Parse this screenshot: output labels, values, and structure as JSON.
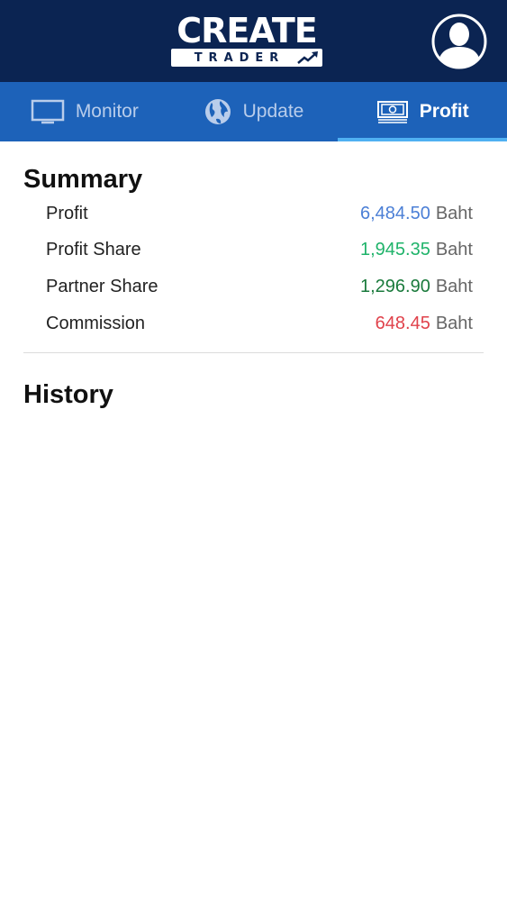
{
  "header": {
    "logo_top": "CREATE",
    "logo_bottom": "TRADER",
    "avatar_icon": "user-avatar-icon"
  },
  "tabs": [
    {
      "label": "Monitor",
      "icon": "monitor-icon",
      "active": false
    },
    {
      "label": "Update",
      "icon": "globe-icon",
      "active": false
    },
    {
      "label": "Profit",
      "icon": "banknote-icon",
      "active": true
    }
  ],
  "summary": {
    "title": "Summary",
    "rows": [
      {
        "label": "Profit",
        "value": "6,484.50",
        "unit": "Baht",
        "color": "#4b7fd6"
      },
      {
        "label": "Profit Share",
        "value": "1,945.35",
        "unit": "Baht",
        "color": "#1fb36a"
      },
      {
        "label": "Partner Share",
        "value": "1,296.90",
        "unit": "Baht",
        "color": "#1a7a3c"
      },
      {
        "label": "Commission",
        "value": "648.45",
        "unit": "Baht",
        "color": "#e0424b"
      }
    ]
  },
  "history": {
    "title": "History"
  },
  "colors": {
    "header_bg": "#0b2452",
    "tab_bar_bg": "#1d62b9",
    "tab_active_indicator": "#4fb0f2"
  }
}
